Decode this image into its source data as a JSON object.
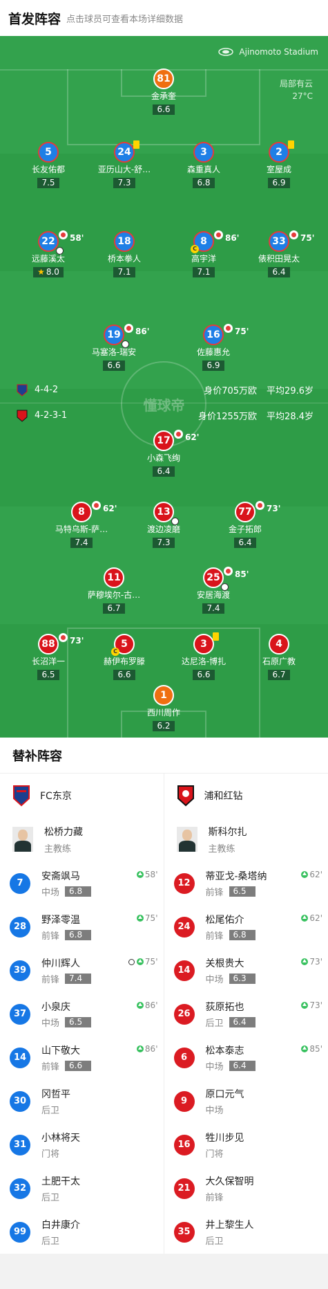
{
  "header": {
    "title": "首发阵容",
    "subtitle": "点击球员可查看本场详细数据"
  },
  "pitch": {
    "stadium": "Ajinomoto Stadium",
    "weather": "局部有云",
    "temperature": "27°C",
    "watermark": "懂球帝",
    "home_team": {
      "formation": "4-4-2",
      "value": "身价705万欧",
      "age": "平均29.6岁",
      "color": "#1e7fe6"
    },
    "away_team": {
      "formation": "4-2-3-1",
      "value": "身价1255万欧",
      "age": "平均28.4岁",
      "color": "#d9141b"
    },
    "home_players": [
      {
        "number": "81",
        "name": "金承奎",
        "rating": "6.6"
      },
      {
        "number": "5",
        "name": "长友佑都",
        "rating": "7.5"
      },
      {
        "number": "24",
        "name": "亚历山大-舒…",
        "rating": "7.3",
        "card": "yellow"
      },
      {
        "number": "3",
        "name": "森重真人",
        "rating": "6.8"
      },
      {
        "number": "2",
        "name": "室屋成",
        "rating": "6.9",
        "card": "yellow"
      },
      {
        "number": "22",
        "name": "远藤溪太",
        "rating": "8.0",
        "sub": "58'",
        "goal": true,
        "star": true
      },
      {
        "number": "18",
        "name": "桥本拳人",
        "rating": "7.1"
      },
      {
        "number": "8",
        "name": "高宇洋",
        "rating": "7.1",
        "sub": "86'",
        "captain": true
      },
      {
        "number": "33",
        "name": "俵积田晃太",
        "rating": "6.4",
        "sub": "75'"
      },
      {
        "number": "19",
        "name": "马塞洛-瑞安",
        "rating": "6.6",
        "sub": "86'",
        "goal": true
      },
      {
        "number": "16",
        "name": "佐藤惠允",
        "rating": "6.9",
        "sub": "75'"
      }
    ],
    "away_players": [
      {
        "number": "17",
        "name": "小森飞绚",
        "rating": "6.4",
        "sub": "62'"
      },
      {
        "number": "8",
        "name": "马特乌斯-萨…",
        "rating": "7.4",
        "sub": "62'"
      },
      {
        "number": "13",
        "name": "渡边凌磨",
        "rating": "7.3",
        "goal": true
      },
      {
        "number": "77",
        "name": "金子拓郎",
        "rating": "6.4",
        "sub": "73'"
      },
      {
        "number": "11",
        "name": "萨穆埃尔-古…",
        "rating": "6.7"
      },
      {
        "number": "25",
        "name": "安居海渡",
        "rating": "7.4",
        "sub": "85'",
        "goal": true
      },
      {
        "number": "88",
        "name": "长沼洋一",
        "rating": "6.5",
        "sub": "73'"
      },
      {
        "number": "5",
        "name": "赫伊布罗滕",
        "rating": "6.6",
        "captain": true
      },
      {
        "number": "3",
        "name": "达尼洛-博扎",
        "rating": "6.6",
        "card": "yellow"
      },
      {
        "number": "4",
        "name": "石原广教",
        "rating": "6.7"
      },
      {
        "number": "1",
        "name": "西川周作",
        "rating": "6.2"
      }
    ]
  },
  "subs": {
    "title": "替补阵容",
    "home": {
      "team": "FC东京",
      "coach": {
        "name": "松桥力藏",
        "role": "主教练"
      },
      "players": [
        {
          "number": "7",
          "name": "安斋飒马",
          "position": "中场",
          "rating": "6.8",
          "time": "58'"
        },
        {
          "number": "28",
          "name": "野泽零温",
          "position": "前锋",
          "rating": "6.8",
          "time": "75'"
        },
        {
          "number": "39",
          "name": "仲川辉人",
          "position": "前锋",
          "rating": "7.4",
          "time": "75'",
          "goal": true
        },
        {
          "number": "37",
          "name": "小泉庆",
          "position": "中场",
          "rating": "6.5",
          "time": "86'"
        },
        {
          "number": "14",
          "name": "山下敬大",
          "position": "前锋",
          "rating": "6.6",
          "time": "86'"
        },
        {
          "number": "30",
          "name": "冈哲平",
          "position": "后卫"
        },
        {
          "number": "31",
          "name": "小林将天",
          "position": "门将"
        },
        {
          "number": "32",
          "name": "土肥干太",
          "position": "后卫"
        },
        {
          "number": "99",
          "name": "白井康介",
          "position": "后卫"
        }
      ]
    },
    "away": {
      "team": "浦和红钻",
      "coach": {
        "name": "斯科尔扎",
        "role": "主教练"
      },
      "players": [
        {
          "number": "12",
          "name": "蒂亚戈-桑塔纳",
          "position": "前锋",
          "rating": "6.5",
          "time": "62'"
        },
        {
          "number": "24",
          "name": "松尾佑介",
          "position": "前锋",
          "rating": "6.8",
          "time": "62'"
        },
        {
          "number": "14",
          "name": "关根贵大",
          "position": "中场",
          "rating": "6.3",
          "time": "73'"
        },
        {
          "number": "26",
          "name": "荻原拓也",
          "position": "后卫",
          "rating": "6.4",
          "time": "73'"
        },
        {
          "number": "6",
          "name": "松本泰志",
          "position": "中场",
          "rating": "6.4",
          "time": "85'"
        },
        {
          "number": "9",
          "name": "原口元气",
          "position": "中场"
        },
        {
          "number": "16",
          "name": "牲川步见",
          "position": "门将"
        },
        {
          "number": "21",
          "name": "大久保智明",
          "position": "前锋"
        },
        {
          "number": "35",
          "name": "井上黎生人",
          "position": "后卫"
        }
      ]
    }
  }
}
